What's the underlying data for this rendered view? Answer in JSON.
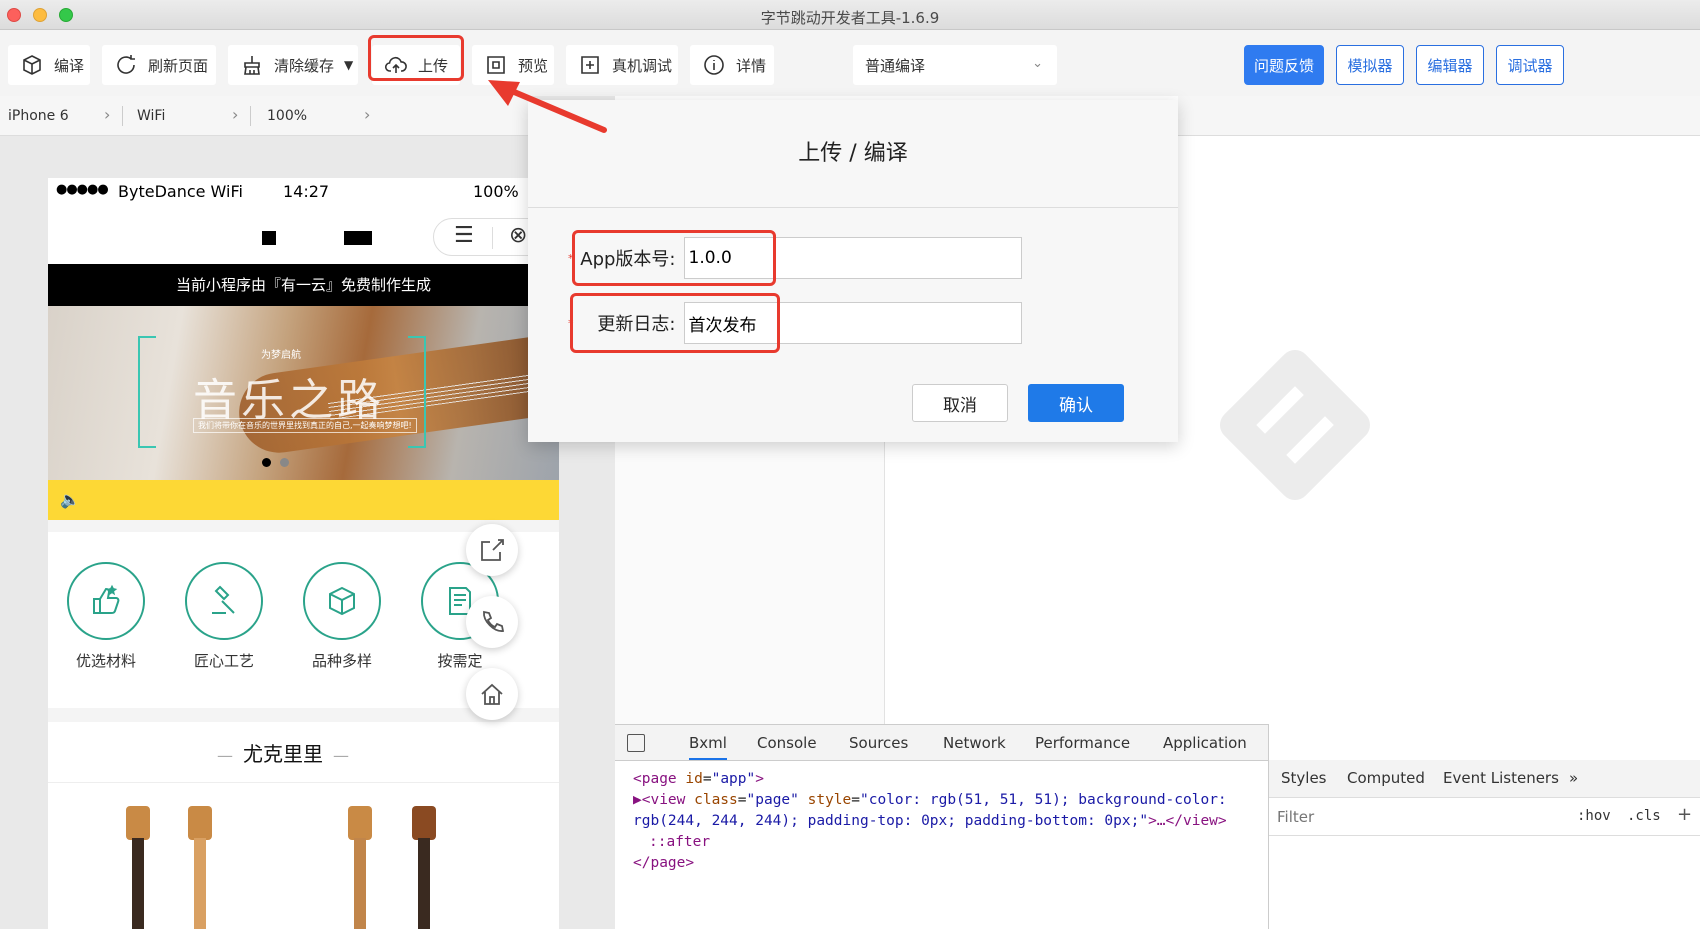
{
  "window": {
    "title": "字节跳动开发者工具-1.6.9"
  },
  "toolbar": {
    "compile": "编译",
    "refresh": "刷新页面",
    "clear_cache": "清除缓存",
    "upload": "上传",
    "preview": "预览",
    "remote_debug": "真机调试",
    "details": "详情",
    "compile_mode": "普通编译",
    "feedback": "问题反馈",
    "simulator": "模拟器",
    "editor": "编辑器",
    "debugger": "调试器"
  },
  "device_bar": {
    "device": "iPhone 6",
    "network": "WiFi",
    "zoom": "100%"
  },
  "phone": {
    "status": {
      "signal": "●●●●●",
      "carrier": "ByteDance WiFi",
      "time": "14:27",
      "battery": "100%"
    },
    "capsule": {
      "menu": "☰",
      "close": "⊗"
    },
    "banner_text": "当前小程序由『有一云』免费制作生成",
    "hero": {
      "title": "音乐之路",
      "tag": "为梦启航",
      "desc": "我们将带你在音乐的世界里找到真正的自己,一起奏响梦想吧!"
    },
    "notice_icon": "🔈",
    "features": [
      {
        "label": "优选材料",
        "icon": "thumbs-up-icon"
      },
      {
        "label": "匠心工艺",
        "icon": "hammer-icon"
      },
      {
        "label": "品种多样",
        "icon": "box-icon"
      },
      {
        "label": "按需定",
        "icon": "document-icon"
      }
    ],
    "section_title": "尤克里里",
    "section_dash": "—"
  },
  "dialog": {
    "title": "上传 / 编译",
    "version_label": "App版本号:",
    "version_value": "1.0.0",
    "changelog_label": "更新日志:",
    "changelog_value": "首次发布",
    "required_mark": "*",
    "cancel": "取消",
    "confirm": "确认"
  },
  "devtools": {
    "tabs": [
      "Bxml",
      "Console",
      "Sources",
      "Network",
      "Performance",
      "Application"
    ],
    "active_tab": "Bxml",
    "code": {
      "line1_open": "<page ",
      "line1_attr": "id",
      "line1_val": "\"app\"",
      "line1_close": ">",
      "line2_open": "▶<view ",
      "line2_attr1": "class",
      "line2_val1": "\"page\"",
      "line2_attr2": " style",
      "line2_val2": "\"color: rgb(51, 51, 51); background-color:",
      "line3": "rgb(244, 244, 244); padding-top: 0px; padding-bottom: 0px;\"",
      "line3_tail": ">…</view>",
      "line4": "::after",
      "line5": "</page>"
    },
    "styles_tabs": [
      "Styles",
      "Computed",
      "Event Listeners",
      "»"
    ],
    "filter_placeholder": "Filter",
    "hov": ":hov",
    "cls": ".cls",
    "plus": "+"
  },
  "colors": {
    "accent": "#2f7bf0",
    "highlight": "#e83a2e",
    "teal": "#2aa38a",
    "notice": "#fdd835"
  }
}
